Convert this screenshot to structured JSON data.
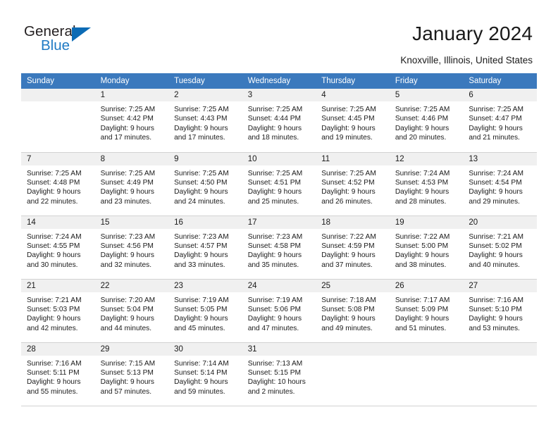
{
  "brand": {
    "name_top": "General",
    "name_bottom": "Blue",
    "triangle_icon": "triangle-icon",
    "color_dark": "#231f20",
    "color_blue": "#1f7ac4"
  },
  "header": {
    "title": "January 2024",
    "subtitle": "Knoxville, Illinois, United States"
  },
  "theme": {
    "header_row_bg": "#3b79bd",
    "header_row_text": "#ffffff",
    "daynum_band_bg": "#f0f0f0",
    "cell_bg": "#ffffff",
    "grid_line": "#d2d2d2",
    "text": "#1a1a1a"
  },
  "weekdays": [
    "Sunday",
    "Monday",
    "Tuesday",
    "Wednesday",
    "Thursday",
    "Friday",
    "Saturday"
  ],
  "labels": {
    "sunrise_prefix": "Sunrise:",
    "sunset_prefix": "Sunset:",
    "daylight_prefix": "Daylight:"
  },
  "weeks": [
    [
      {
        "day": "",
        "empty": true,
        "sunrise": "",
        "sunset": "",
        "daylight_line1": "",
        "daylight_line2": ""
      },
      {
        "day": "1",
        "sunrise": "Sunrise: 7:25 AM",
        "sunset": "Sunset: 4:42 PM",
        "daylight_line1": "Daylight: 9 hours",
        "daylight_line2": "and 17 minutes."
      },
      {
        "day": "2",
        "sunrise": "Sunrise: 7:25 AM",
        "sunset": "Sunset: 4:43 PM",
        "daylight_line1": "Daylight: 9 hours",
        "daylight_line2": "and 17 minutes."
      },
      {
        "day": "3",
        "sunrise": "Sunrise: 7:25 AM",
        "sunset": "Sunset: 4:44 PM",
        "daylight_line1": "Daylight: 9 hours",
        "daylight_line2": "and 18 minutes."
      },
      {
        "day": "4",
        "sunrise": "Sunrise: 7:25 AM",
        "sunset": "Sunset: 4:45 PM",
        "daylight_line1": "Daylight: 9 hours",
        "daylight_line2": "and 19 minutes."
      },
      {
        "day": "5",
        "sunrise": "Sunrise: 7:25 AM",
        "sunset": "Sunset: 4:46 PM",
        "daylight_line1": "Daylight: 9 hours",
        "daylight_line2": "and 20 minutes."
      },
      {
        "day": "6",
        "sunrise": "Sunrise: 7:25 AM",
        "sunset": "Sunset: 4:47 PM",
        "daylight_line1": "Daylight: 9 hours",
        "daylight_line2": "and 21 minutes."
      }
    ],
    [
      {
        "day": "7",
        "sunrise": "Sunrise: 7:25 AM",
        "sunset": "Sunset: 4:48 PM",
        "daylight_line1": "Daylight: 9 hours",
        "daylight_line2": "and 22 minutes."
      },
      {
        "day": "8",
        "sunrise": "Sunrise: 7:25 AM",
        "sunset": "Sunset: 4:49 PM",
        "daylight_line1": "Daylight: 9 hours",
        "daylight_line2": "and 23 minutes."
      },
      {
        "day": "9",
        "sunrise": "Sunrise: 7:25 AM",
        "sunset": "Sunset: 4:50 PM",
        "daylight_line1": "Daylight: 9 hours",
        "daylight_line2": "and 24 minutes."
      },
      {
        "day": "10",
        "sunrise": "Sunrise: 7:25 AM",
        "sunset": "Sunset: 4:51 PM",
        "daylight_line1": "Daylight: 9 hours",
        "daylight_line2": "and 25 minutes."
      },
      {
        "day": "11",
        "sunrise": "Sunrise: 7:25 AM",
        "sunset": "Sunset: 4:52 PM",
        "daylight_line1": "Daylight: 9 hours",
        "daylight_line2": "and 26 minutes."
      },
      {
        "day": "12",
        "sunrise": "Sunrise: 7:24 AM",
        "sunset": "Sunset: 4:53 PM",
        "daylight_line1": "Daylight: 9 hours",
        "daylight_line2": "and 28 minutes."
      },
      {
        "day": "13",
        "sunrise": "Sunrise: 7:24 AM",
        "sunset": "Sunset: 4:54 PM",
        "daylight_line1": "Daylight: 9 hours",
        "daylight_line2": "and 29 minutes."
      }
    ],
    [
      {
        "day": "14",
        "sunrise": "Sunrise: 7:24 AM",
        "sunset": "Sunset: 4:55 PM",
        "daylight_line1": "Daylight: 9 hours",
        "daylight_line2": "and 30 minutes."
      },
      {
        "day": "15",
        "sunrise": "Sunrise: 7:23 AM",
        "sunset": "Sunset: 4:56 PM",
        "daylight_line1": "Daylight: 9 hours",
        "daylight_line2": "and 32 minutes."
      },
      {
        "day": "16",
        "sunrise": "Sunrise: 7:23 AM",
        "sunset": "Sunset: 4:57 PM",
        "daylight_line1": "Daylight: 9 hours",
        "daylight_line2": "and 33 minutes."
      },
      {
        "day": "17",
        "sunrise": "Sunrise: 7:23 AM",
        "sunset": "Sunset: 4:58 PM",
        "daylight_line1": "Daylight: 9 hours",
        "daylight_line2": "and 35 minutes."
      },
      {
        "day": "18",
        "sunrise": "Sunrise: 7:22 AM",
        "sunset": "Sunset: 4:59 PM",
        "daylight_line1": "Daylight: 9 hours",
        "daylight_line2": "and 37 minutes."
      },
      {
        "day": "19",
        "sunrise": "Sunrise: 7:22 AM",
        "sunset": "Sunset: 5:00 PM",
        "daylight_line1": "Daylight: 9 hours",
        "daylight_line2": "and 38 minutes."
      },
      {
        "day": "20",
        "sunrise": "Sunrise: 7:21 AM",
        "sunset": "Sunset: 5:02 PM",
        "daylight_line1": "Daylight: 9 hours",
        "daylight_line2": "and 40 minutes."
      }
    ],
    [
      {
        "day": "21",
        "sunrise": "Sunrise: 7:21 AM",
        "sunset": "Sunset: 5:03 PM",
        "daylight_line1": "Daylight: 9 hours",
        "daylight_line2": "and 42 minutes."
      },
      {
        "day": "22",
        "sunrise": "Sunrise: 7:20 AM",
        "sunset": "Sunset: 5:04 PM",
        "daylight_line1": "Daylight: 9 hours",
        "daylight_line2": "and 44 minutes."
      },
      {
        "day": "23",
        "sunrise": "Sunrise: 7:19 AM",
        "sunset": "Sunset: 5:05 PM",
        "daylight_line1": "Daylight: 9 hours",
        "daylight_line2": "and 45 minutes."
      },
      {
        "day": "24",
        "sunrise": "Sunrise: 7:19 AM",
        "sunset": "Sunset: 5:06 PM",
        "daylight_line1": "Daylight: 9 hours",
        "daylight_line2": "and 47 minutes."
      },
      {
        "day": "25",
        "sunrise": "Sunrise: 7:18 AM",
        "sunset": "Sunset: 5:08 PM",
        "daylight_line1": "Daylight: 9 hours",
        "daylight_line2": "and 49 minutes."
      },
      {
        "day": "26",
        "sunrise": "Sunrise: 7:17 AM",
        "sunset": "Sunset: 5:09 PM",
        "daylight_line1": "Daylight: 9 hours",
        "daylight_line2": "and 51 minutes."
      },
      {
        "day": "27",
        "sunrise": "Sunrise: 7:16 AM",
        "sunset": "Sunset: 5:10 PM",
        "daylight_line1": "Daylight: 9 hours",
        "daylight_line2": "and 53 minutes."
      }
    ],
    [
      {
        "day": "28",
        "sunrise": "Sunrise: 7:16 AM",
        "sunset": "Sunset: 5:11 PM",
        "daylight_line1": "Daylight: 9 hours",
        "daylight_line2": "and 55 minutes."
      },
      {
        "day": "29",
        "sunrise": "Sunrise: 7:15 AM",
        "sunset": "Sunset: 5:13 PM",
        "daylight_line1": "Daylight: 9 hours",
        "daylight_line2": "and 57 minutes."
      },
      {
        "day": "30",
        "sunrise": "Sunrise: 7:14 AM",
        "sunset": "Sunset: 5:14 PM",
        "daylight_line1": "Daylight: 9 hours",
        "daylight_line2": "and 59 minutes."
      },
      {
        "day": "31",
        "sunrise": "Sunrise: 7:13 AM",
        "sunset": "Sunset: 5:15 PM",
        "daylight_line1": "Daylight: 10 hours",
        "daylight_line2": "and 2 minutes."
      },
      {
        "day": "",
        "empty": true,
        "sunrise": "",
        "sunset": "",
        "daylight_line1": "",
        "daylight_line2": ""
      },
      {
        "day": "",
        "empty": true,
        "sunrise": "",
        "sunset": "",
        "daylight_line1": "",
        "daylight_line2": ""
      },
      {
        "day": "",
        "empty": true,
        "sunrise": "",
        "sunset": "",
        "daylight_line1": "",
        "daylight_line2": ""
      }
    ]
  ]
}
